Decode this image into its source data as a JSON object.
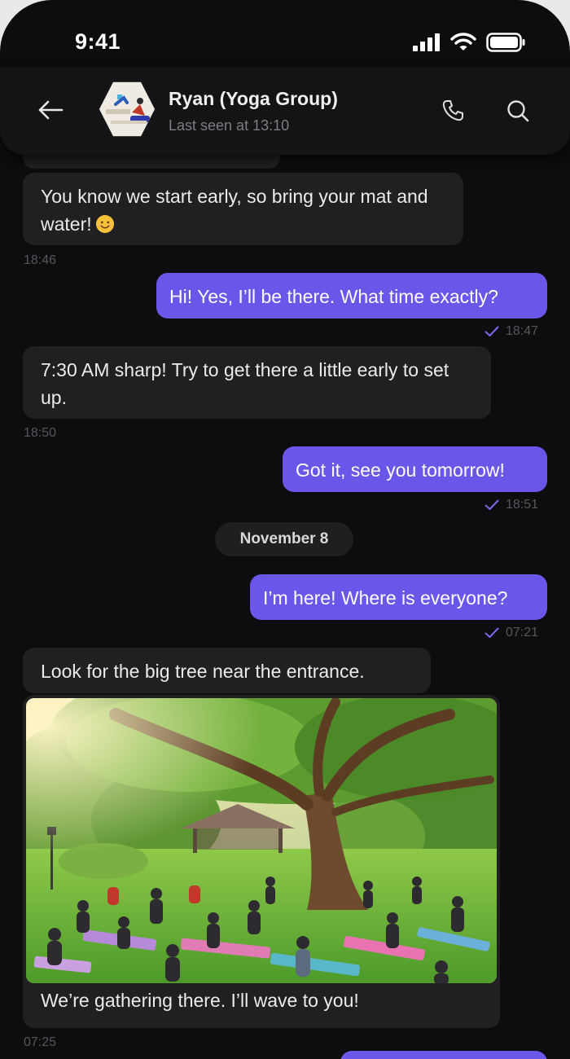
{
  "status_bar": {
    "time": "9:41"
  },
  "header": {
    "back_icon": "arrow-left-icon",
    "contact_name": "Ryan (Yoga Group)",
    "last_seen": "Last seen at 13:10",
    "call_icon": "phone-icon",
    "search_icon": "search-icon"
  },
  "messages": [
    {
      "direction": "incoming",
      "text": "You know we start early, so bring your mat and water!",
      "emoji": "smiling-face-emoji",
      "time": "18:46"
    },
    {
      "direction": "outgoing",
      "text": "Hi! Yes, I’ll be there. What time exactly?",
      "time": "18:47",
      "status": "sent"
    },
    {
      "direction": "incoming",
      "text": "7:30 AM sharp! Try to get there a little early to set up.",
      "time": "18:50"
    },
    {
      "direction": "outgoing",
      "text": "Got it, see you tomorrow!",
      "time": "18:51",
      "status": "sent"
    },
    {
      "direction": "outgoing",
      "text": "I’m here! Where is everyone?",
      "time": "07:21",
      "status": "sent"
    },
    {
      "direction": "incoming",
      "text": "Look for the big tree near the entrance."
    },
    {
      "direction": "incoming",
      "type": "image",
      "image": "park-yoga-under-tree-photo",
      "caption": "We’re gathering there. I’ll wave to you!",
      "time": "07:25"
    }
  ],
  "date_separator": "November 8",
  "colors": {
    "background": "#0d0d0f",
    "incoming_bubble": "#202023",
    "outgoing_bubble": "#6a57ea",
    "timestamp": "#56565b",
    "check": "#7b68ee"
  }
}
